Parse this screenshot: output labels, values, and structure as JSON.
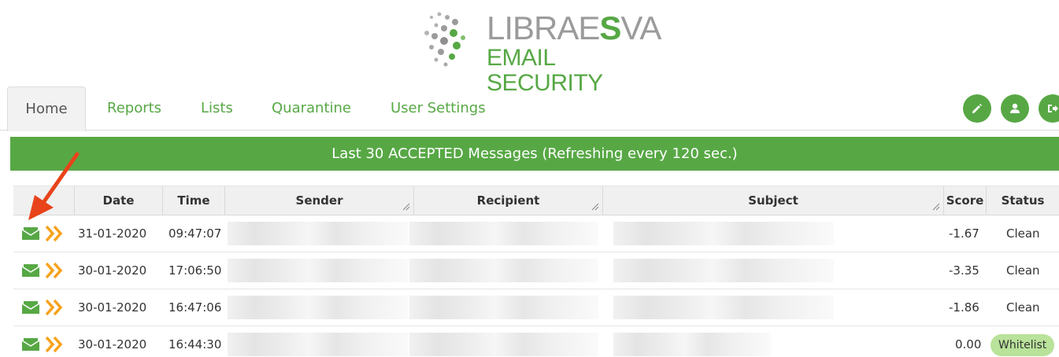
{
  "logo": {
    "brand_main": "LIBRAE",
    "brand_accent": "S",
    "brand_end": "VA",
    "tagline": "EMAIL SECURITY"
  },
  "nav": {
    "tabs": [
      {
        "label": "Home",
        "active": true
      },
      {
        "label": "Reports"
      },
      {
        "label": "Lists"
      },
      {
        "label": "Quarantine"
      },
      {
        "label": "User Settings"
      }
    ],
    "actions": [
      "pencil-icon",
      "user-icon",
      "logout-icon"
    ]
  },
  "banner": {
    "title": "Last 30 ACCEPTED Messages (Refreshing every 120 sec.)"
  },
  "table": {
    "headers": [
      "",
      "Date",
      "Time",
      "Sender",
      "Recipient",
      "Subject",
      "Score",
      "Status"
    ],
    "rows": [
      {
        "date": "31-01-2020",
        "time": "09:47:07",
        "score": "-1.67",
        "status": "Clean"
      },
      {
        "date": "30-01-2020",
        "time": "17:06:50",
        "score": "-3.35",
        "status": "Clean"
      },
      {
        "date": "30-01-2020",
        "time": "16:47:06",
        "score": "-1.86",
        "status": "Clean"
      },
      {
        "date": "30-01-2020",
        "time": "16:44:30",
        "score": "0.00",
        "status": "Whitelist"
      }
    ]
  },
  "colors": {
    "brand_green": "#57a845",
    "logo_gray": "#9b9b9b",
    "arrow_accent": "#f7a21b",
    "whitelist_badge": "#b9e29a",
    "annotation_arrow": "#e8431a"
  }
}
